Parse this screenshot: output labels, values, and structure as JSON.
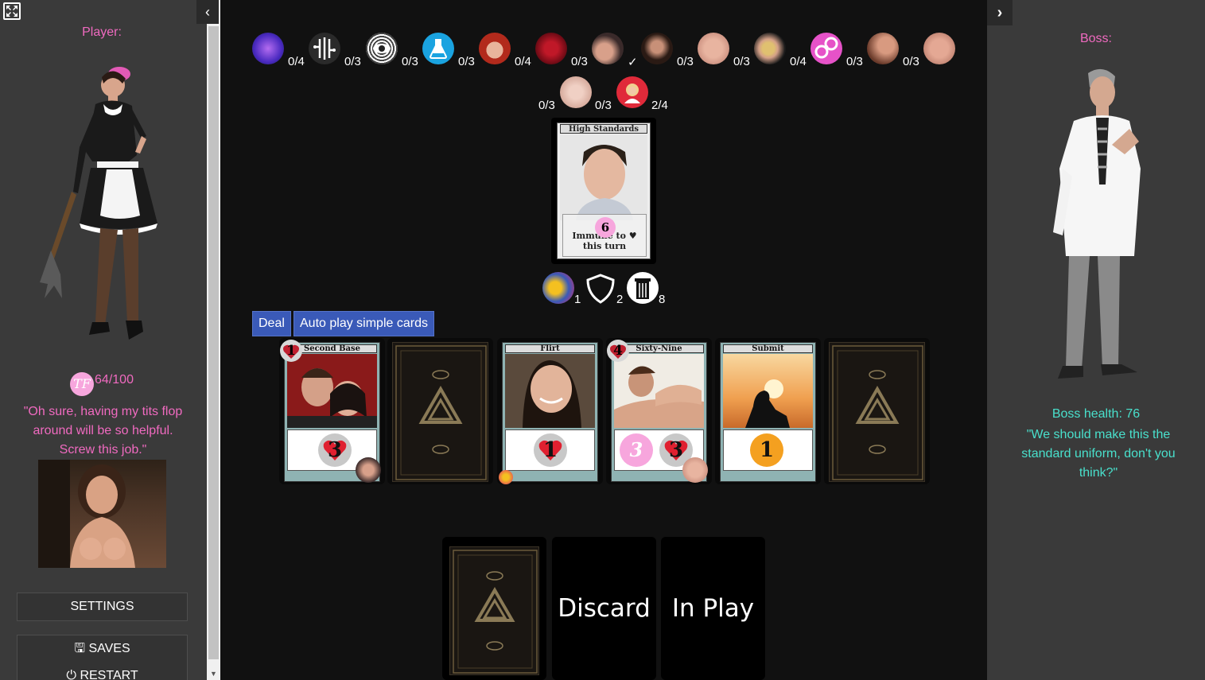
{
  "left": {
    "player_label": "Player:",
    "tf_badge": "TF",
    "tf_value": "64/100",
    "quote": "\"Oh sure, having my tits flop around will be so helpful. Screw this job.\"",
    "settings": "SETTINGS",
    "saves": "SAVES",
    "restart": "RESTART"
  },
  "right": {
    "boss_label": "Boss:",
    "boss_health": "Boss health: 76",
    "quote": "\"We should make this the standard uniform, don't you think?\""
  },
  "status_row1": [
    {
      "icon": "brain-icon",
      "count": "0/4"
    },
    {
      "icon": "circuit-icon",
      "count": "0/3"
    },
    {
      "icon": "hypno-eye-icon",
      "count": "0/3"
    },
    {
      "icon": "potion-icon",
      "count": "0/3"
    },
    {
      "icon": "redhead-icon",
      "count": "0/4"
    },
    {
      "icon": "lips-icon",
      "count": "0/3"
    },
    {
      "icon": "body-icon",
      "count": "✓"
    },
    {
      "icon": "dark-woman-icon",
      "count": "0/3"
    },
    {
      "icon": "skin-icon",
      "count": "0/3"
    },
    {
      "icon": "blonde-icon",
      "count": "0/4"
    },
    {
      "icon": "handcuffs-icon",
      "count": "0/3"
    },
    {
      "icon": "finger-icon",
      "count": "0/3"
    },
    {
      "icon": "tongue-icon",
      "count": ""
    }
  ],
  "status_row2": [
    {
      "icon": "mouth-icon",
      "count": "0/3"
    },
    {
      "icon": "maid-icon",
      "count": "0/3"
    },
    {
      "icon": "",
      "count": "2/4"
    }
  ],
  "boss_card": {
    "title": "High Standards",
    "hp": "6",
    "immune_text": "Immune to ♥ this turn"
  },
  "deck_info": [
    {
      "icon": "draw-icon",
      "num": "1"
    },
    {
      "icon": "shield-icon",
      "num": "2"
    },
    {
      "icon": "trash-icon",
      "num": "8"
    }
  ],
  "buttons": {
    "deal": "Deal",
    "autoplay": "Auto play simple cards"
  },
  "hand": [
    {
      "title": "Second Base",
      "cost": "1",
      "effect": "3"
    },
    {
      "title": "",
      "cost": "",
      "effect": ""
    },
    {
      "title": "Flirt",
      "cost": "",
      "effect": "1"
    },
    {
      "title": "Sixty-Nine",
      "cost": "4",
      "effect": "3",
      "effect_tf": "3"
    },
    {
      "title": "Submit",
      "cost": "",
      "effect": "1"
    },
    {
      "title": "",
      "cost": "",
      "effect": ""
    }
  ],
  "piles": {
    "discard": "Discard",
    "in_play": "In Play"
  },
  "colors": {
    "pink": "#f06ac0",
    "teal": "#49e0cc",
    "blue_button": "#3a5ab8",
    "sidebar": "#3a3a3a"
  }
}
